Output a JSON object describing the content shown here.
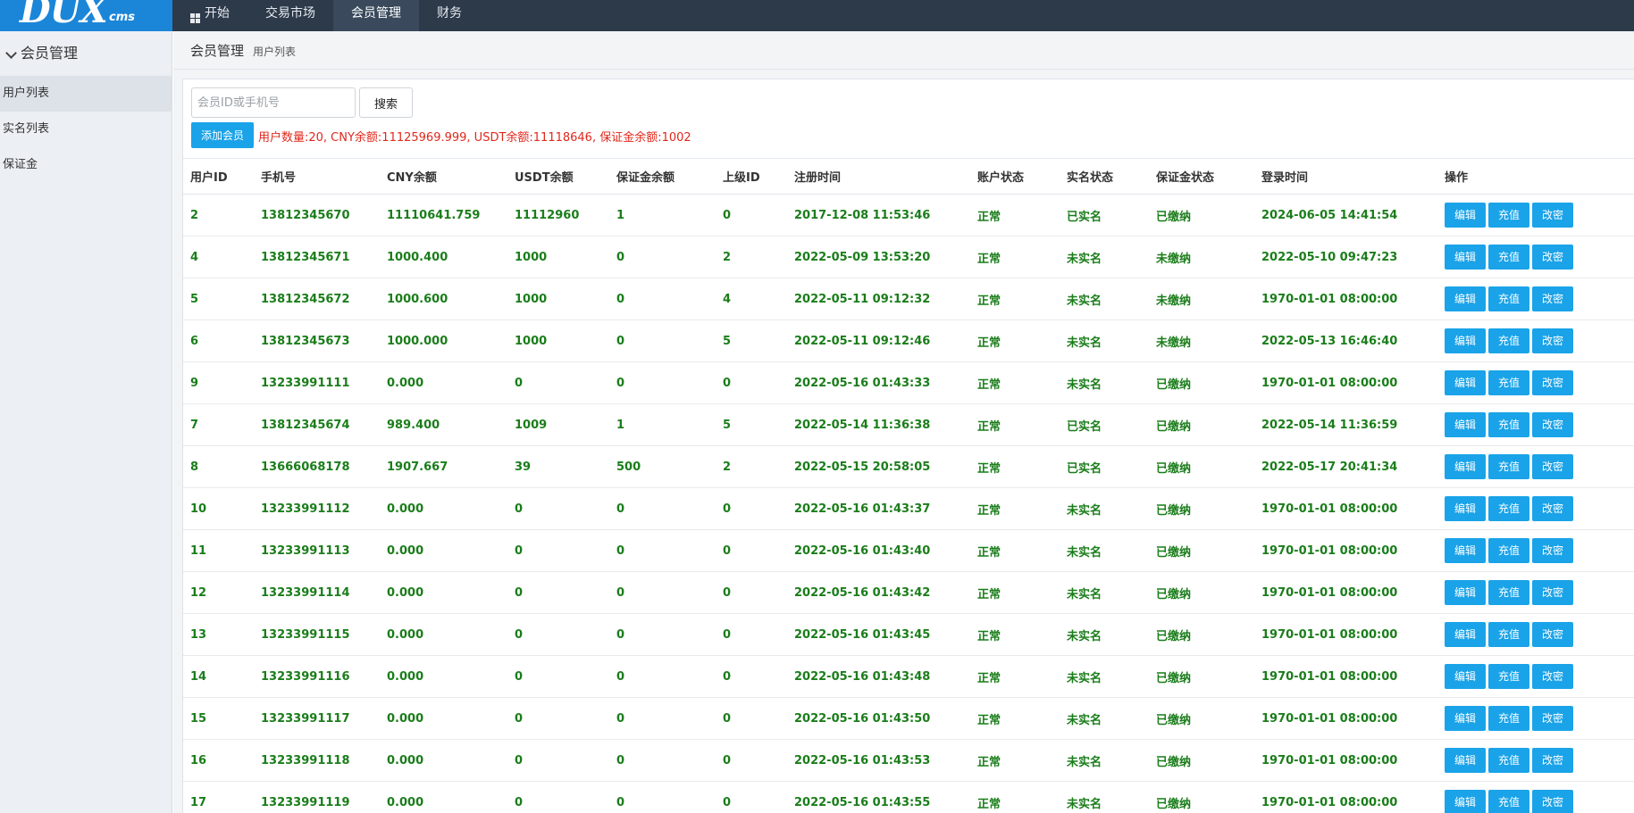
{
  "logo": {
    "main": "DUX",
    "sub": "cms"
  },
  "topnav": [
    {
      "label": "开始",
      "icon": "windows-icon"
    },
    {
      "label": "交易市场"
    },
    {
      "label": "会员管理",
      "active": true
    },
    {
      "label": "财务"
    }
  ],
  "sidebar": {
    "header": "会员管理",
    "items": [
      {
        "label": "用户列表",
        "active": true
      },
      {
        "label": "实名列表"
      },
      {
        "label": "保证金"
      }
    ]
  },
  "breadcrumb": {
    "main": "会员管理",
    "sub": "用户列表"
  },
  "search": {
    "placeholder": "会员ID或手机号",
    "button": "搜索"
  },
  "add_button": "添加会员",
  "summary": "用户数量:20, CNY余额:11125969.999, USDT余额:11118646, 保证金余额:1002",
  "colors": {
    "accent": "#1aa3e8",
    "topbar": "#2c3a4a",
    "logo_bg": "#1b86d8",
    "row_text": "#1a7d1a",
    "summary_text": "#e0281c"
  },
  "table": {
    "headers": [
      "用户ID",
      "手机号",
      "CNY余额",
      "USDT余额",
      "保证金余额",
      "上级ID",
      "注册时间",
      "账户状态",
      "实名状态",
      "保证金状态",
      "登录时间",
      "操作"
    ],
    "actions": [
      "编辑",
      "充值",
      "改密"
    ],
    "rows": [
      [
        "2",
        "13812345670",
        "11110641.759",
        "11112960",
        "1",
        "0",
        "2017-12-08 11:53:46",
        "正常",
        "已实名",
        "已缴纳",
        "2024-06-05 14:41:54"
      ],
      [
        "4",
        "13812345671",
        "1000.400",
        "1000",
        "0",
        "2",
        "2022-05-09 13:53:20",
        "正常",
        "未实名",
        "未缴纳",
        "2022-05-10 09:47:23"
      ],
      [
        "5",
        "13812345672",
        "1000.600",
        "1000",
        "0",
        "4",
        "2022-05-11 09:12:32",
        "正常",
        "未实名",
        "未缴纳",
        "1970-01-01 08:00:00"
      ],
      [
        "6",
        "13812345673",
        "1000.000",
        "1000",
        "0",
        "5",
        "2022-05-11 09:12:46",
        "正常",
        "未实名",
        "未缴纳",
        "2022-05-13 16:46:40"
      ],
      [
        "9",
        "13233991111",
        "0.000",
        "0",
        "0",
        "0",
        "2022-05-16 01:43:33",
        "正常",
        "未实名",
        "已缴纳",
        "1970-01-01 08:00:00"
      ],
      [
        "7",
        "13812345674",
        "989.400",
        "1009",
        "1",
        "5",
        "2022-05-14 11:36:38",
        "正常",
        "已实名",
        "已缴纳",
        "2022-05-14 11:36:59"
      ],
      [
        "8",
        "13666068178",
        "1907.667",
        "39",
        "500",
        "2",
        "2022-05-15 20:58:05",
        "正常",
        "已实名",
        "已缴纳",
        "2022-05-17 20:41:34"
      ],
      [
        "10",
        "13233991112",
        "0.000",
        "0",
        "0",
        "0",
        "2022-05-16 01:43:37",
        "正常",
        "未实名",
        "已缴纳",
        "1970-01-01 08:00:00"
      ],
      [
        "11",
        "13233991113",
        "0.000",
        "0",
        "0",
        "0",
        "2022-05-16 01:43:40",
        "正常",
        "未实名",
        "已缴纳",
        "1970-01-01 08:00:00"
      ],
      [
        "12",
        "13233991114",
        "0.000",
        "0",
        "0",
        "0",
        "2022-05-16 01:43:42",
        "正常",
        "未实名",
        "已缴纳",
        "1970-01-01 08:00:00"
      ],
      [
        "13",
        "13233991115",
        "0.000",
        "0",
        "0",
        "0",
        "2022-05-16 01:43:45",
        "正常",
        "未实名",
        "已缴纳",
        "1970-01-01 08:00:00"
      ],
      [
        "14",
        "13233991116",
        "0.000",
        "0",
        "0",
        "0",
        "2022-05-16 01:43:48",
        "正常",
        "未实名",
        "已缴纳",
        "1970-01-01 08:00:00"
      ],
      [
        "15",
        "13233991117",
        "0.000",
        "0",
        "0",
        "0",
        "2022-05-16 01:43:50",
        "正常",
        "未实名",
        "已缴纳",
        "1970-01-01 08:00:00"
      ],
      [
        "16",
        "13233991118",
        "0.000",
        "0",
        "0",
        "0",
        "2022-05-16 01:43:53",
        "正常",
        "未实名",
        "已缴纳",
        "1970-01-01 08:00:00"
      ],
      [
        "17",
        "13233991119",
        "0.000",
        "0",
        "0",
        "0",
        "2022-05-16 01:43:55",
        "正常",
        "未实名",
        "已缴纳",
        "1970-01-01 08:00:00"
      ]
    ]
  }
}
